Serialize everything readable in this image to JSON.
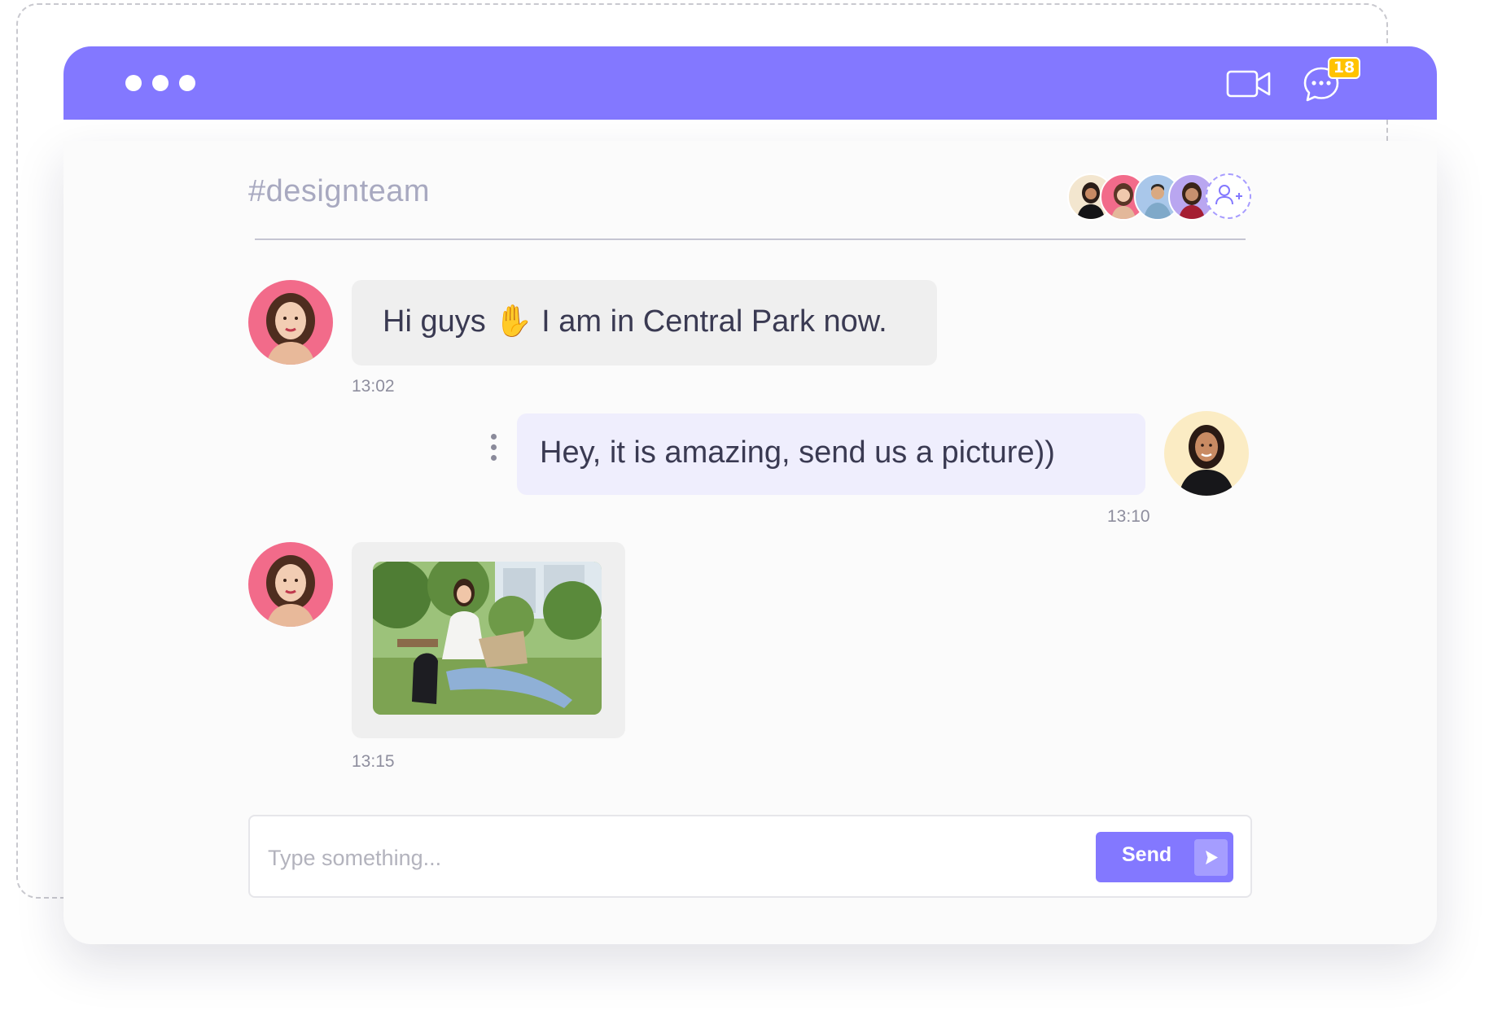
{
  "window": {
    "video_icon": "video-camera-icon",
    "chat_icon": "chat-bubble-icon",
    "unread_count": "18",
    "accent_color": "#8378ff",
    "badge_color": "#ffc300"
  },
  "channel": {
    "name": "#designteam",
    "members": [
      "member-1",
      "member-2",
      "member-3",
      "member-4"
    ],
    "add_member_icon": "add-user-icon"
  },
  "messages": [
    {
      "direction": "incoming",
      "text_before": "Hi guys ",
      "emoji": "✋",
      "text_after": " I am in Central Park now.",
      "time": "13:02"
    },
    {
      "direction": "outgoing",
      "text": "Hey, it is amazing, send us a picture))",
      "time": "13:10"
    },
    {
      "direction": "incoming",
      "attachment": "photo",
      "time": "13:15"
    }
  ],
  "composer": {
    "placeholder": "Type something...",
    "send_label": "Send",
    "send_icon": "send-arrow-icon"
  }
}
